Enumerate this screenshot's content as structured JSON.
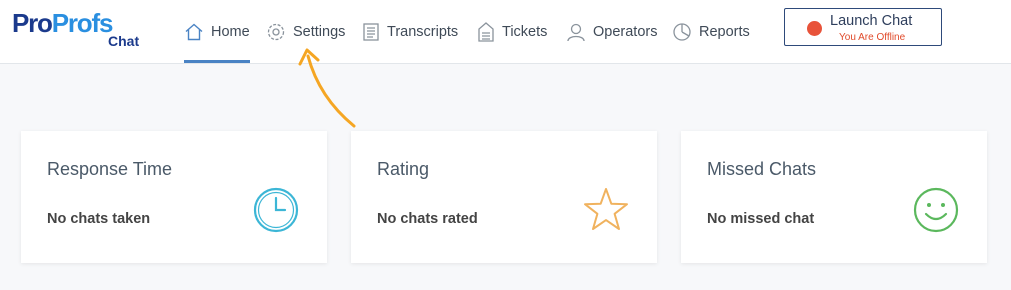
{
  "logo": {
    "part1": "Pro",
    "part2": "Profs",
    "sub": "Chat"
  },
  "nav": [
    {
      "label": "Home",
      "icon": "home-icon",
      "active": true
    },
    {
      "label": "Settings",
      "icon": "gear-icon",
      "active": false
    },
    {
      "label": "Transcripts",
      "icon": "document-icon",
      "active": false
    },
    {
      "label": "Tickets",
      "icon": "ticket-icon",
      "active": false
    },
    {
      "label": "Operators",
      "icon": "user-icon",
      "active": false
    },
    {
      "label": "Reports",
      "icon": "pie-chart-icon",
      "active": false
    }
  ],
  "launch": {
    "label": "Launch Chat",
    "status": "You Are Offline",
    "status_color": "#e04a2a"
  },
  "cards": [
    {
      "title": "Response Time",
      "value": "No chats taken",
      "icon": "clock-icon",
      "icon_color": "#3cb6d6"
    },
    {
      "title": "Rating",
      "value": "No chats rated",
      "icon": "star-icon",
      "icon_color": "#f0b25e"
    },
    {
      "title": "Missed Chats",
      "value": "No missed chat",
      "icon": "smiley-icon",
      "icon_color": "#5bb85d"
    }
  ],
  "colors": {
    "accent": "#4a83c4",
    "annotation_arrow": "#f5a623"
  }
}
